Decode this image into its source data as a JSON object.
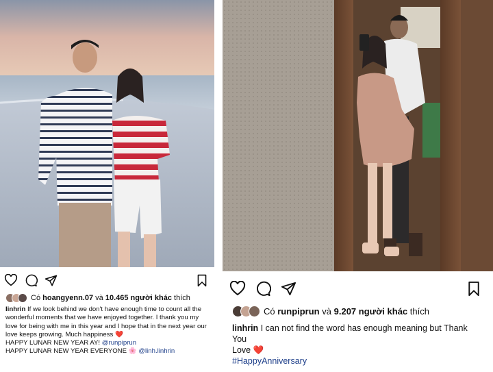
{
  "left_post": {
    "liked_by_prefix": "Có",
    "liked_by_user": "hoangyenn.07",
    "liked_by_and": "và",
    "liked_by_count": "10.465 người khác",
    "liked_by_suffix": "thích",
    "caption_user": "linhrin",
    "caption_text": "If we look behind we don't have enough time to count all the wonderful moments that we have enjoyed together. I thank you my love for being with me in this year and I hope that in the next year our love keeps growing. Much happiness",
    "line2_text": "HAPPY LUNAR NEW YEAR AY!",
    "line2_mention": "@runpiprun",
    "line3_text": "HAPPY LUNAR NEW YEAR EVERYONE",
    "line3_mention": "@linh.linhrin",
    "heart_glyph": "❤️",
    "flower_glyph": "🌸"
  },
  "right_post": {
    "liked_by_prefix": "Có",
    "liked_by_user": "runpiprun",
    "liked_by_and": "và",
    "liked_by_count": "9.207 người khác",
    "liked_by_suffix": "thích",
    "caption_user": "linhrin",
    "caption_text": "I can not find the word has enough meaning but Thank You",
    "line2_text": "Love",
    "heart_glyph": "❤️",
    "hashtag": "#HappyAnniversary"
  },
  "icons": {
    "like": "heart-outline-icon",
    "comment": "comment-bubble-icon",
    "share": "paper-plane-icon",
    "save": "bookmark-icon"
  },
  "colors": {
    "mention": "#1e3f8a",
    "heart": "#e0242f"
  }
}
